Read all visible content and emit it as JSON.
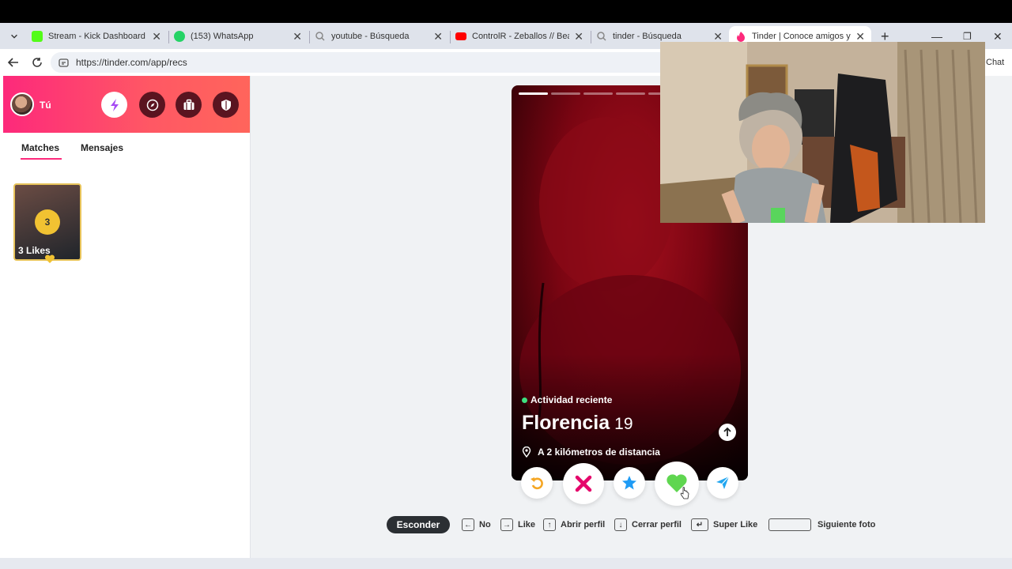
{
  "browser": {
    "tabs": [
      {
        "title": "Stream - Kick Dashboard",
        "icon": "kick-icon",
        "color": "#53fc18"
      },
      {
        "title": "(153) WhatsApp",
        "icon": "whatsapp-icon",
        "color": "#25d366"
      },
      {
        "title": "youtube - Búsqueda",
        "icon": "search-icon",
        "color": "#888888"
      },
      {
        "title": "ControlR - Zeballos // Beat: N",
        "icon": "youtube-icon",
        "color": "#ff0000"
      },
      {
        "title": "tinder - Búsqueda",
        "icon": "search-icon",
        "color": "#888888"
      },
      {
        "title": "Tinder | Conoce amigos y ge",
        "icon": "tinder-icon",
        "color": "#fd297b"
      }
    ],
    "url": "https://tinder.com/app/recs",
    "chat_label": "Chat"
  },
  "sidebar": {
    "user_label": "Tú",
    "tabs": [
      "Matches",
      "Mensajes"
    ],
    "likes_count": "3",
    "likes_label": "3 Likes"
  },
  "profile": {
    "activity": "Actividad reciente",
    "name": "Florencia",
    "age": "19",
    "distance": "A 2 kilómetros de distancia",
    "photo_count": 5,
    "current_photo": 1
  },
  "hints": {
    "hide": "Esconder",
    "no": "No",
    "like": "Like",
    "open": "Abrir perfil",
    "close": "Cerrar perfil",
    "superlike": "Super Like",
    "next": "Siguiente foto"
  },
  "colors": {
    "brand_start": "#fd297b",
    "brand_end": "#ff655b",
    "like": "#3ee07f",
    "nope": "#e5066b",
    "superlike": "#1e9bf5",
    "rewind": "#f5a623",
    "boost": "#22a6f0"
  }
}
